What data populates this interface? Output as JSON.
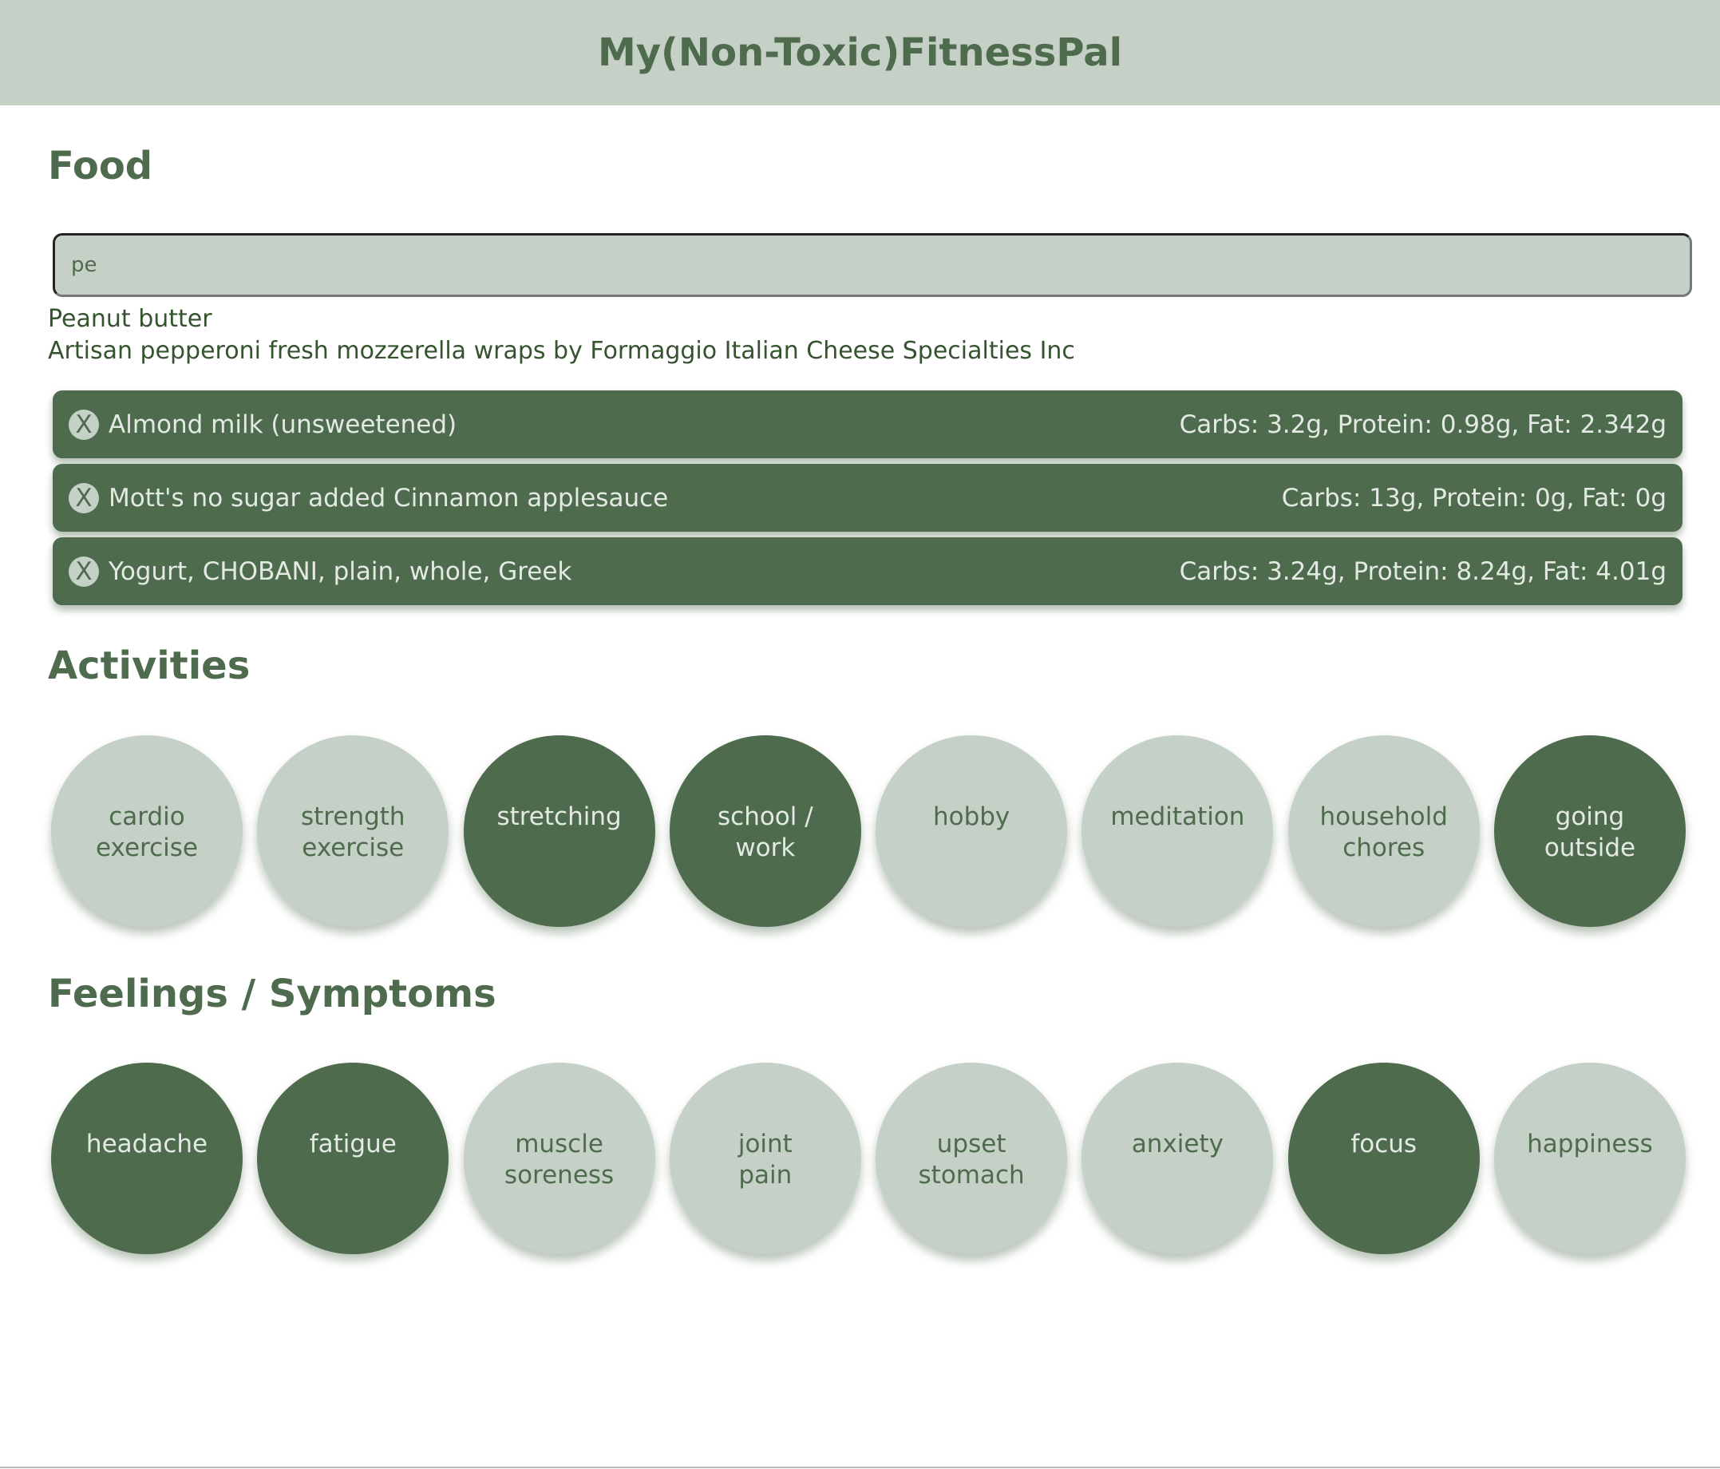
{
  "app": {
    "title": "My(Non-Toxic)FitnessPal"
  },
  "colors": {
    "header_bg": "#c5d0c7",
    "accent_dark": "#4f6b4d",
    "accent_light": "#c5d0c7"
  },
  "food": {
    "title": "Food",
    "search_value": "pe",
    "suggestions": [
      "Peanut butter",
      "Artisan pepperoni fresh mozzerella wraps by Formaggio Italian Cheese Specialties Inc"
    ],
    "items": [
      {
        "remove_label": "X",
        "name": "Almond milk (unsweetened)",
        "macros": "Carbs: 3.2g, Protein: 0.98g, Fat: 2.342g"
      },
      {
        "remove_label": "X",
        "name": "Mott's no sugar added Cinnamon applesauce",
        "macros": "Carbs: 13g, Protein: 0g, Fat: 0g"
      },
      {
        "remove_label": "X",
        "name": "Yogurt, CHOBANI, plain, whole, Greek",
        "macros": "Carbs: 3.24g, Protein: 8.24g, Fat: 4.01g"
      }
    ]
  },
  "activities": {
    "title": "Activities",
    "items": [
      {
        "label": "cardio\nexercise",
        "selected": false
      },
      {
        "label": "strength\nexercise",
        "selected": false
      },
      {
        "label": "stretching",
        "selected": true
      },
      {
        "label": "school /\nwork",
        "selected": true
      },
      {
        "label": "hobby",
        "selected": false
      },
      {
        "label": "meditation",
        "selected": false
      },
      {
        "label": "household\nchores",
        "selected": false
      },
      {
        "label": "going\noutside",
        "selected": true
      }
    ]
  },
  "feelings": {
    "title": "Feelings / Symptoms",
    "items": [
      {
        "label": "headache",
        "selected": true
      },
      {
        "label": "fatigue",
        "selected": true
      },
      {
        "label": "muscle\nsoreness",
        "selected": false
      },
      {
        "label": "joint\npain",
        "selected": false
      },
      {
        "label": "upset\nstomach",
        "selected": false
      },
      {
        "label": "anxiety",
        "selected": false
      },
      {
        "label": "focus",
        "selected": true
      },
      {
        "label": "happiness",
        "selected": false
      }
    ]
  }
}
